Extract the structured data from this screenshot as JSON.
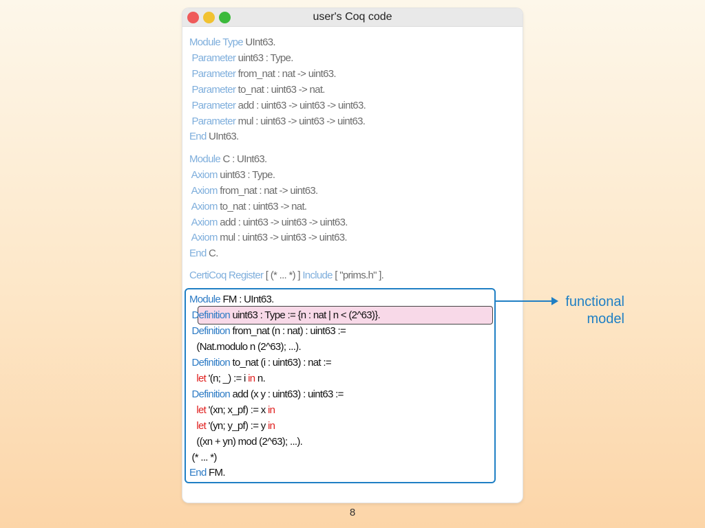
{
  "window": {
    "title": "user's Coq code",
    "traffic_lights": [
      "close",
      "minimize",
      "maximize"
    ]
  },
  "colors": {
    "keyword": "#2d7bc5",
    "in_keyword": "#e0201f",
    "highlight_fill": "#f8d9e8",
    "box_border": "#1f7fc4"
  },
  "code": {
    "uint63_module_type": {
      "l1": {
        "kw": "Module Type",
        "text": " UInt63."
      },
      "l2": {
        "kw": " Parameter",
        "text": " uint63 : Type."
      },
      "l3": {
        "kw": " Parameter",
        "text": " from_nat : nat -> uint63."
      },
      "l4": {
        "kw": " Parameter",
        "text": " to_nat : uint63 -> nat."
      },
      "l5": {
        "kw": " Parameter",
        "text": " add : uint63 -> uint63 -> uint63."
      },
      "l6": {
        "kw": " Parameter",
        "text": " mul : uint63 -> uint63 -> uint63."
      },
      "l7": {
        "kw": "End",
        "text": " UInt63."
      }
    },
    "module_c": {
      "l1": {
        "kw": "Module",
        "text": " C : UInt63."
      },
      "l2": {
        "kw": " Axiom",
        "text": " uint63 : Type."
      },
      "l3": {
        "kw": " Axiom",
        "text": " from_nat : nat -> uint63."
      },
      "l4": {
        "kw": " Axiom",
        "text": " to_nat : uint63 -> nat."
      },
      "l5": {
        "kw": " Axiom",
        "text": " add : uint63 -> uint63 -> uint63."
      },
      "l6": {
        "kw": " Axiom",
        "text": " mul : uint63 -> uint63 -> uint63."
      },
      "l7": {
        "kw": "End",
        "text": " C."
      }
    },
    "certicoq_register": {
      "kw1": "CertiCoq Register",
      "mid": " [ (* ... *) ] ",
      "kw2": "Include",
      "text": " [ \"prims.h\" ]."
    },
    "module_fm": {
      "l1": {
        "kw": "Module",
        "text": " FM : UInt63."
      },
      "l2": {
        "kw": " Definition",
        "text": " uint63 : Type := {n : nat | n < (2^63)}."
      },
      "l3": {
        "kw": " Definition",
        "text": " from_nat (n : nat) : uint63 :="
      },
      "l4": {
        "text": "   (Nat.modulo n (2^63); ...)."
      },
      "l5": {
        "kw": " Definition",
        "text": " to_nat (i : uint63) : nat :="
      },
      "l6": {
        "kw": "   let",
        "text_a": " '(n; _) := i ",
        "red": "in",
        "text_b": " n."
      },
      "l7": {
        "kw": " Definition",
        "text": " add (x y : uint63) : uint63 :="
      },
      "l8": {
        "kw": "   let",
        "text_a": " '(xn; x_pf) := x ",
        "red": "in"
      },
      "l9": {
        "kw": "   let",
        "text_a": " '(yn; y_pf) := y ",
        "red": "in"
      },
      "l10": {
        "text": "   ((xn + yn) mod (2^63); ...)."
      },
      "l11": {
        "text": " (* ... *)"
      },
      "l12": {
        "kw": "End",
        "text": " FM."
      }
    }
  },
  "annotation": {
    "line1": "functional",
    "line2": "model"
  },
  "page_number": "8"
}
